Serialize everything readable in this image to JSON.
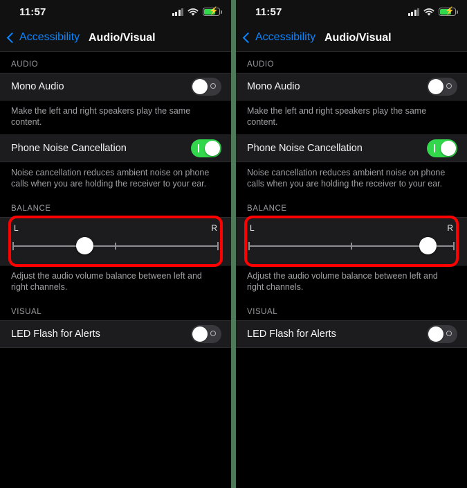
{
  "statusbar": {
    "time": "11:57",
    "icons": {
      "signal": "cellular-bars-icon",
      "wifi": "wifi-icon",
      "battery": "battery-charging-icon"
    }
  },
  "navbar": {
    "back_label": "Accessibility",
    "title": "Audio/Visual"
  },
  "sections": {
    "audio_header": "AUDIO",
    "balance_header": "BALANCE",
    "visual_header": "VISUAL"
  },
  "rows": {
    "mono_audio": {
      "label": "Mono Audio",
      "state": "off",
      "footnote": "Make the left and right speakers play the same content."
    },
    "phone_noise_cancellation": {
      "label": "Phone Noise Cancellation",
      "state": "on",
      "footnote": "Noise cancellation reduces ambient noise on phone calls when you are holding the receiver to your ear."
    },
    "led_flash": {
      "label": "LED Flash for Alerts",
      "state": "off"
    }
  },
  "balance": {
    "left_label": "L",
    "right_label": "R",
    "footnote": "Adjust the audio volume balance between left and right channels.",
    "left_panel_value_pct": 35,
    "right_panel_value_pct": 87
  },
  "colors": {
    "accent_blue": "#0a84ff",
    "toggle_on_green": "#32d74b",
    "annotation_red": "#ff0000",
    "divider_green": "#4f7a5a",
    "row_background": "#1c1c1e",
    "page_background": "#000000"
  }
}
